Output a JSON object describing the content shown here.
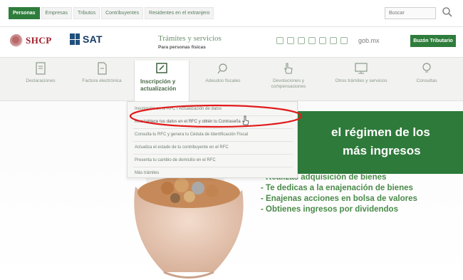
{
  "topbar": {
    "tabs": [
      {
        "label": "Personas",
        "active": true
      },
      {
        "label": "Empresas",
        "active": false
      },
      {
        "label": "Tributos",
        "active": false
      },
      {
        "label": "Contribuyentes",
        "active": false
      },
      {
        "label": "Residentes en el extranjero",
        "active": false
      }
    ],
    "search_placeholder": "Buscar"
  },
  "header": {
    "shcp_logo_text": "SHCP",
    "sat_logo_text": "SAT",
    "site_title": "Trámites y servicios",
    "site_subtitle": "Para personas físicas",
    "gob_text": "gob.mx",
    "buzon_label": "Buzón Tributario"
  },
  "nav": {
    "items": [
      {
        "label": "Declaraciones",
        "icon": "document-icon"
      },
      {
        "label": "Factura electrónica",
        "icon": "invoice-icon"
      },
      {
        "label": "Inscripción y actualización",
        "icon": "register-icon",
        "active": true
      },
      {
        "label": "Adeudos fiscales",
        "icon": "search-money-icon"
      },
      {
        "label": "Devoluciones y compensaciones",
        "icon": "hand-pointer-icon"
      },
      {
        "label": "Otros trámites y servicios",
        "icon": "monitor-icon"
      },
      {
        "label": "Consultas",
        "icon": "lightbulb-icon"
      }
    ]
  },
  "dropdown": {
    "items": [
      {
        "label": "Inscripción en el RFC / Actualización de datos"
      },
      {
        "label": "Reestablece tus datos en el RFC y obtén tu Contraseña",
        "highlighted": true
      },
      {
        "label": "Consulta tu RFC y genera tu Cédula de Identificación Fiscal"
      },
      {
        "label": "Actualiza el estado de tu contribuyente en el RFC"
      },
      {
        "label": "Presenta tu cambio de domicilio en el RFC"
      },
      {
        "label": "Más trámites"
      }
    ]
  },
  "hero": {
    "title_line_1": "el régimen de los",
    "title_line_2": "más ingresos",
    "bullets": [
      "- Realizas adquisición de bienes",
      "- Te dedicas a la enajenación de bienes",
      "- Enajenas acciones en bolsa de valores",
      "- Obtienes ingresos por dividendos"
    ]
  },
  "colors": {
    "brand_green": "#2f7d3c",
    "shcp_red": "#a01d2a",
    "sat_blue": "#163b63",
    "annotation_red": "#e01b1b"
  }
}
